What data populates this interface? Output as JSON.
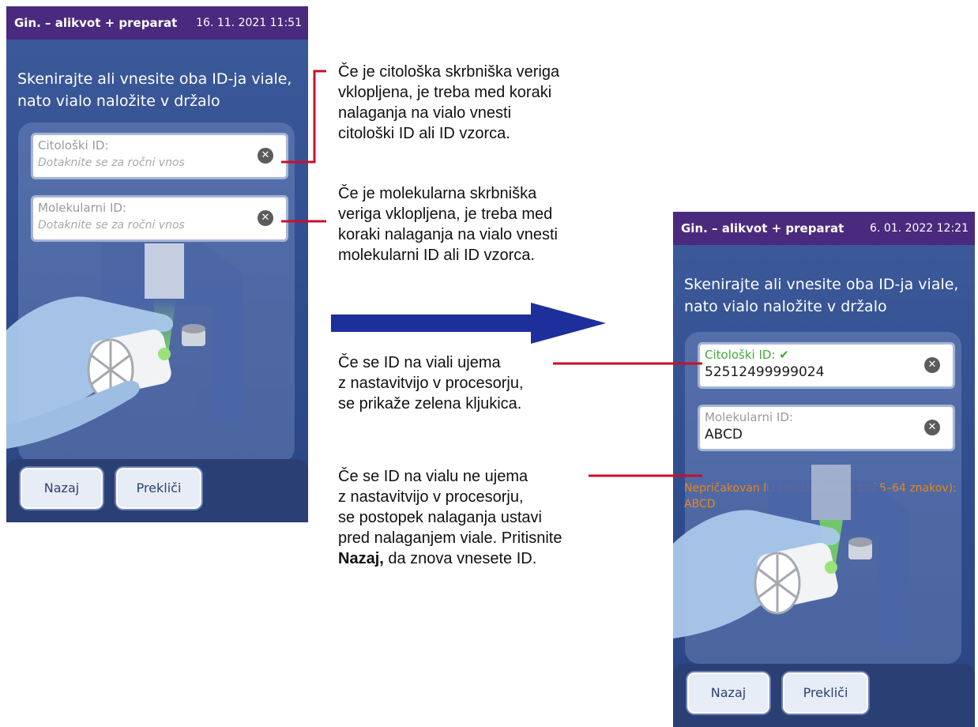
{
  "left_screen": {
    "title": "Gin. – alikvot + preparat",
    "datetime": "16. 11. 2021 11:51",
    "prompt": "Skenirajte ali vnesite oba ID-ja viale, nato vialo naložite v držalo",
    "cyto_label": "Citološki ID:",
    "cyto_hint": "Dotaknite se za ročni vnos",
    "mol_label": "Molekularni ID:",
    "mol_hint": "Dotaknite se za ročni vnos",
    "back_button": "Nazaj",
    "cancel_button": "Prekliči"
  },
  "right_screen": {
    "title": "Gin. – alikvot + preparat",
    "datetime": "6. 01. 2022 12:21",
    "prompt": "Skenirajte ali vnesite oba ID-ja viale, nato vialo naložite v držalo",
    "cyto_label": "Citološki ID:",
    "cyto_check": "✔",
    "cyto_value": "52512499999024",
    "mol_label": "Molekularni ID:",
    "mol_value": "ABCD",
    "error": "Nepričakovan ID (dolžina mora biti 5–64 znakov): ABCD",
    "back_button": "Nazaj",
    "cancel_button": "Prekliči"
  },
  "annotations": {
    "cyto_chain": "Če je citološka skrbniška veriga\nvklopljena, je treba med koraki\nnalaganja na vialo vnesti\ncitološki ID ali ID vzorca.",
    "mol_chain": "Če je molekularna skrbniška\nveriga vklopljena, je treba med\nkoraki nalaganja na vialo vnesti\nmolekularni ID ali ID vzorca.",
    "match": "Če se ID na viali ujema\nz nastavitvijo v procesorju,\nse prikaže zelena kljukica.",
    "mismatch_before": "Če se ID na vialu ne ujema\nz nastavitvijo v procesorju,\nse postopek nalaganja ustavi\npred nalaganjem viale. Pritisnite\n",
    "mismatch_bold": "Nazaj,",
    "mismatch_after": " da znova vnesete ID."
  },
  "colors": {
    "title_bar": "#4a2a7e",
    "screen_bg": "#2f4d8e",
    "callout_line": "#c8102e",
    "arrow": "#1c2f9a",
    "check_green": "#45a83a",
    "error_orange": "#e8861c"
  },
  "icons": {
    "clear": "clear-circle-x-icon",
    "arrow": "right-arrow-icon"
  }
}
